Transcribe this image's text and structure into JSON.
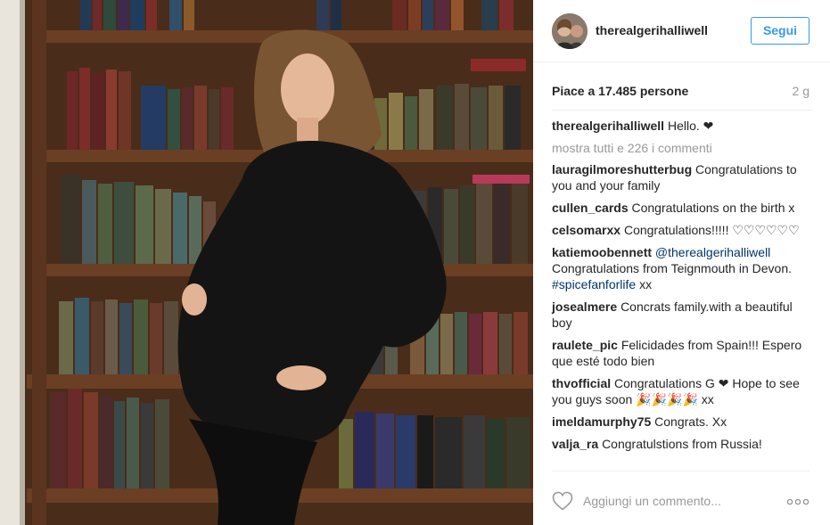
{
  "post": {
    "author": "therealgerihalliwell",
    "follow_label": "Segui",
    "likes_text": "Piace a 17.485 persone",
    "time_text": "2 g"
  },
  "caption": {
    "user": "therealgerihalliwell",
    "text": "Hello. ❤"
  },
  "show_all_comments": "mostra tutti e 226 i commenti",
  "comments": [
    {
      "user": "lauragilmoreshutterbug",
      "text": "Congratulations to you and your family"
    },
    {
      "user": "cullen_cards",
      "text": "Congratulations on the birth x"
    },
    {
      "user": "celsomarxx",
      "text": "Congratulations!!!!! ♡♡♡♡♡♡"
    },
    {
      "user": "katiemoobennett",
      "mention": "@therealgerihalliwell",
      "text": "Congratulations from Teignmouth in Devon.",
      "hashtag": "#spicefanforlife",
      "suffix": "xx"
    },
    {
      "user": "josealmere",
      "text": "Concrats family.with a beautiful boy"
    },
    {
      "user": "raulete_pic",
      "text": "Felicidades from Spain!!! Espero que esté todo bien"
    },
    {
      "user": "thvofficial",
      "text": "Congratulations G ❤ Hope to see you guys soon 🎉🎉🎉🎉 xx"
    },
    {
      "user": "imeldamurphy75",
      "text": "Congrats. Xx"
    },
    {
      "user": "valja_ra",
      "text": "Congratulstions from Russia!"
    }
  ],
  "footer": {
    "add_comment_placeholder": "Aggiungi un commento..."
  },
  "icons": {
    "like": "heart-outline-icon",
    "more": "more-options-icon"
  },
  "colors": {
    "accent": "#3897f0",
    "link": "#003569",
    "muted": "#999999",
    "text": "#262626"
  }
}
